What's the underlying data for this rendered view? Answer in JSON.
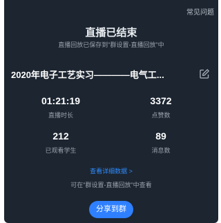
{
  "help_label": "常见问题",
  "header": {
    "title": "直播已结束",
    "subtitle": "直播回放已保存到\"群设置-直播回放\"中"
  },
  "session": {
    "name": "2020年电子工艺实习————电气工..."
  },
  "stats": {
    "duration": {
      "value": "01:21:19",
      "label": "直播时长"
    },
    "likes": {
      "value": "3372",
      "label": "点赞数"
    },
    "viewers": {
      "value": "212",
      "label": "已观看学生"
    },
    "messages": {
      "value": "89",
      "label": "消息数"
    }
  },
  "detail_link": "查看详细数据 >",
  "hint": "可在\"群设置-直播回放\"中查看",
  "share_button": "分享到群",
  "colors": {
    "panel_bg": "#1c2530",
    "accent": "#2f80ff",
    "link": "#2f8cff"
  }
}
